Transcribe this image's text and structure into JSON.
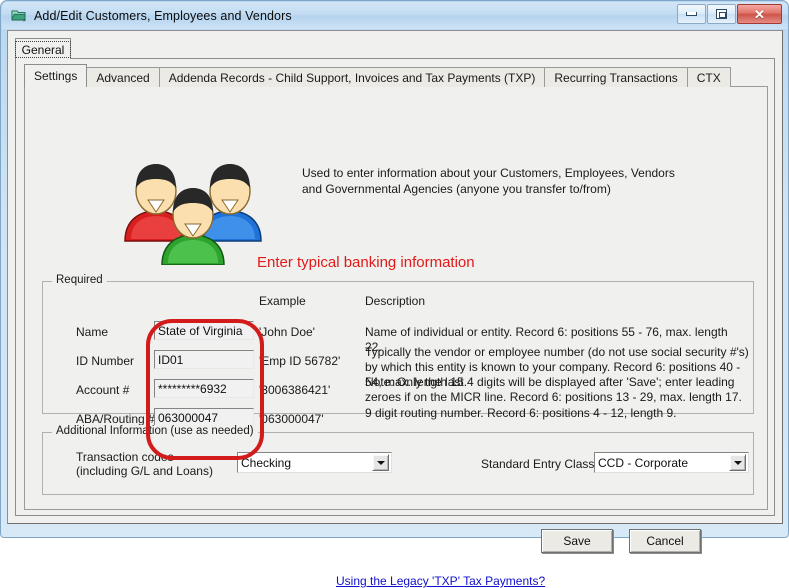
{
  "window": {
    "title": "Add/Edit Customers, Employees and Vendors",
    "icon": "window-folder-icon",
    "minimize_label": "Minimize",
    "maximize_label": "Maximize",
    "close_label": "Close",
    "close_glyph": "✕"
  },
  "outer_tab": {
    "label": "General"
  },
  "inner_tabs": [
    {
      "label": "Settings",
      "active": true
    },
    {
      "label": "Advanced",
      "active": false
    },
    {
      "label": "Addenda Records - Child Support, Invoices and Tax Payments (TXP)",
      "active": false
    },
    {
      "label": "Recurring Transactions",
      "active": false
    },
    {
      "label": "CTX",
      "active": false
    }
  ],
  "header": {
    "illustration": "three-people-icon",
    "intro_line1": "Used to enter information about your Customers, Employees, Vendors",
    "intro_line2": "and Governmental Agencies (anyone you transfer to/from)",
    "banner": "Enter typical banking information",
    "banner_color": "#e01a1a"
  },
  "required_group": {
    "title": "Required",
    "col_example": "Example",
    "col_description": "Description",
    "annotation": {
      "shape": "rounded-rectangle",
      "color": "#d31b1b"
    },
    "rows": [
      {
        "label": "Name",
        "value": "State of Virginia",
        "placeholder": "",
        "example": "'John Doe'",
        "description": "Name of individual or entity. Record 6: positions 55 - 76, max. length 22."
      },
      {
        "label": "ID Number",
        "value": "ID01",
        "placeholder": "",
        "example": "'Emp ID 56782'",
        "description": "Typically the vendor or employee number (do not use social security #'s) by which this entity is known to your company. Record 6: positions 40 - 54, max. length 15."
      },
      {
        "label": "Account #",
        "value": "*********6932",
        "placeholder": "",
        "example": "'3006386421'",
        "description": "Note: Only the last 4 digits will be displayed after 'Save'; enter leading zeroes if on the MICR line. Record 6: positions 13 - 29, max. length 17."
      },
      {
        "label": "ABA/Routing #",
        "value": "063000047",
        "placeholder": "",
        "example": "'063000047'",
        "description": "9 digit routing number. Record 6: positions 4 - 12, length 9."
      }
    ]
  },
  "additional_group": {
    "title": "Additional Information (use as needed)",
    "transaction_label_line1": "Transaction codes",
    "transaction_label_line2": "(including G/L and Loans)",
    "transaction_value": "Checking",
    "sec_label": "Standard Entry Class",
    "sec_value": "CCD - Corporate"
  },
  "footer": {
    "legacy_link": "Using the Legacy 'TXP' Tax Payments?",
    "save_label": "Save",
    "cancel_label": "Cancel"
  }
}
